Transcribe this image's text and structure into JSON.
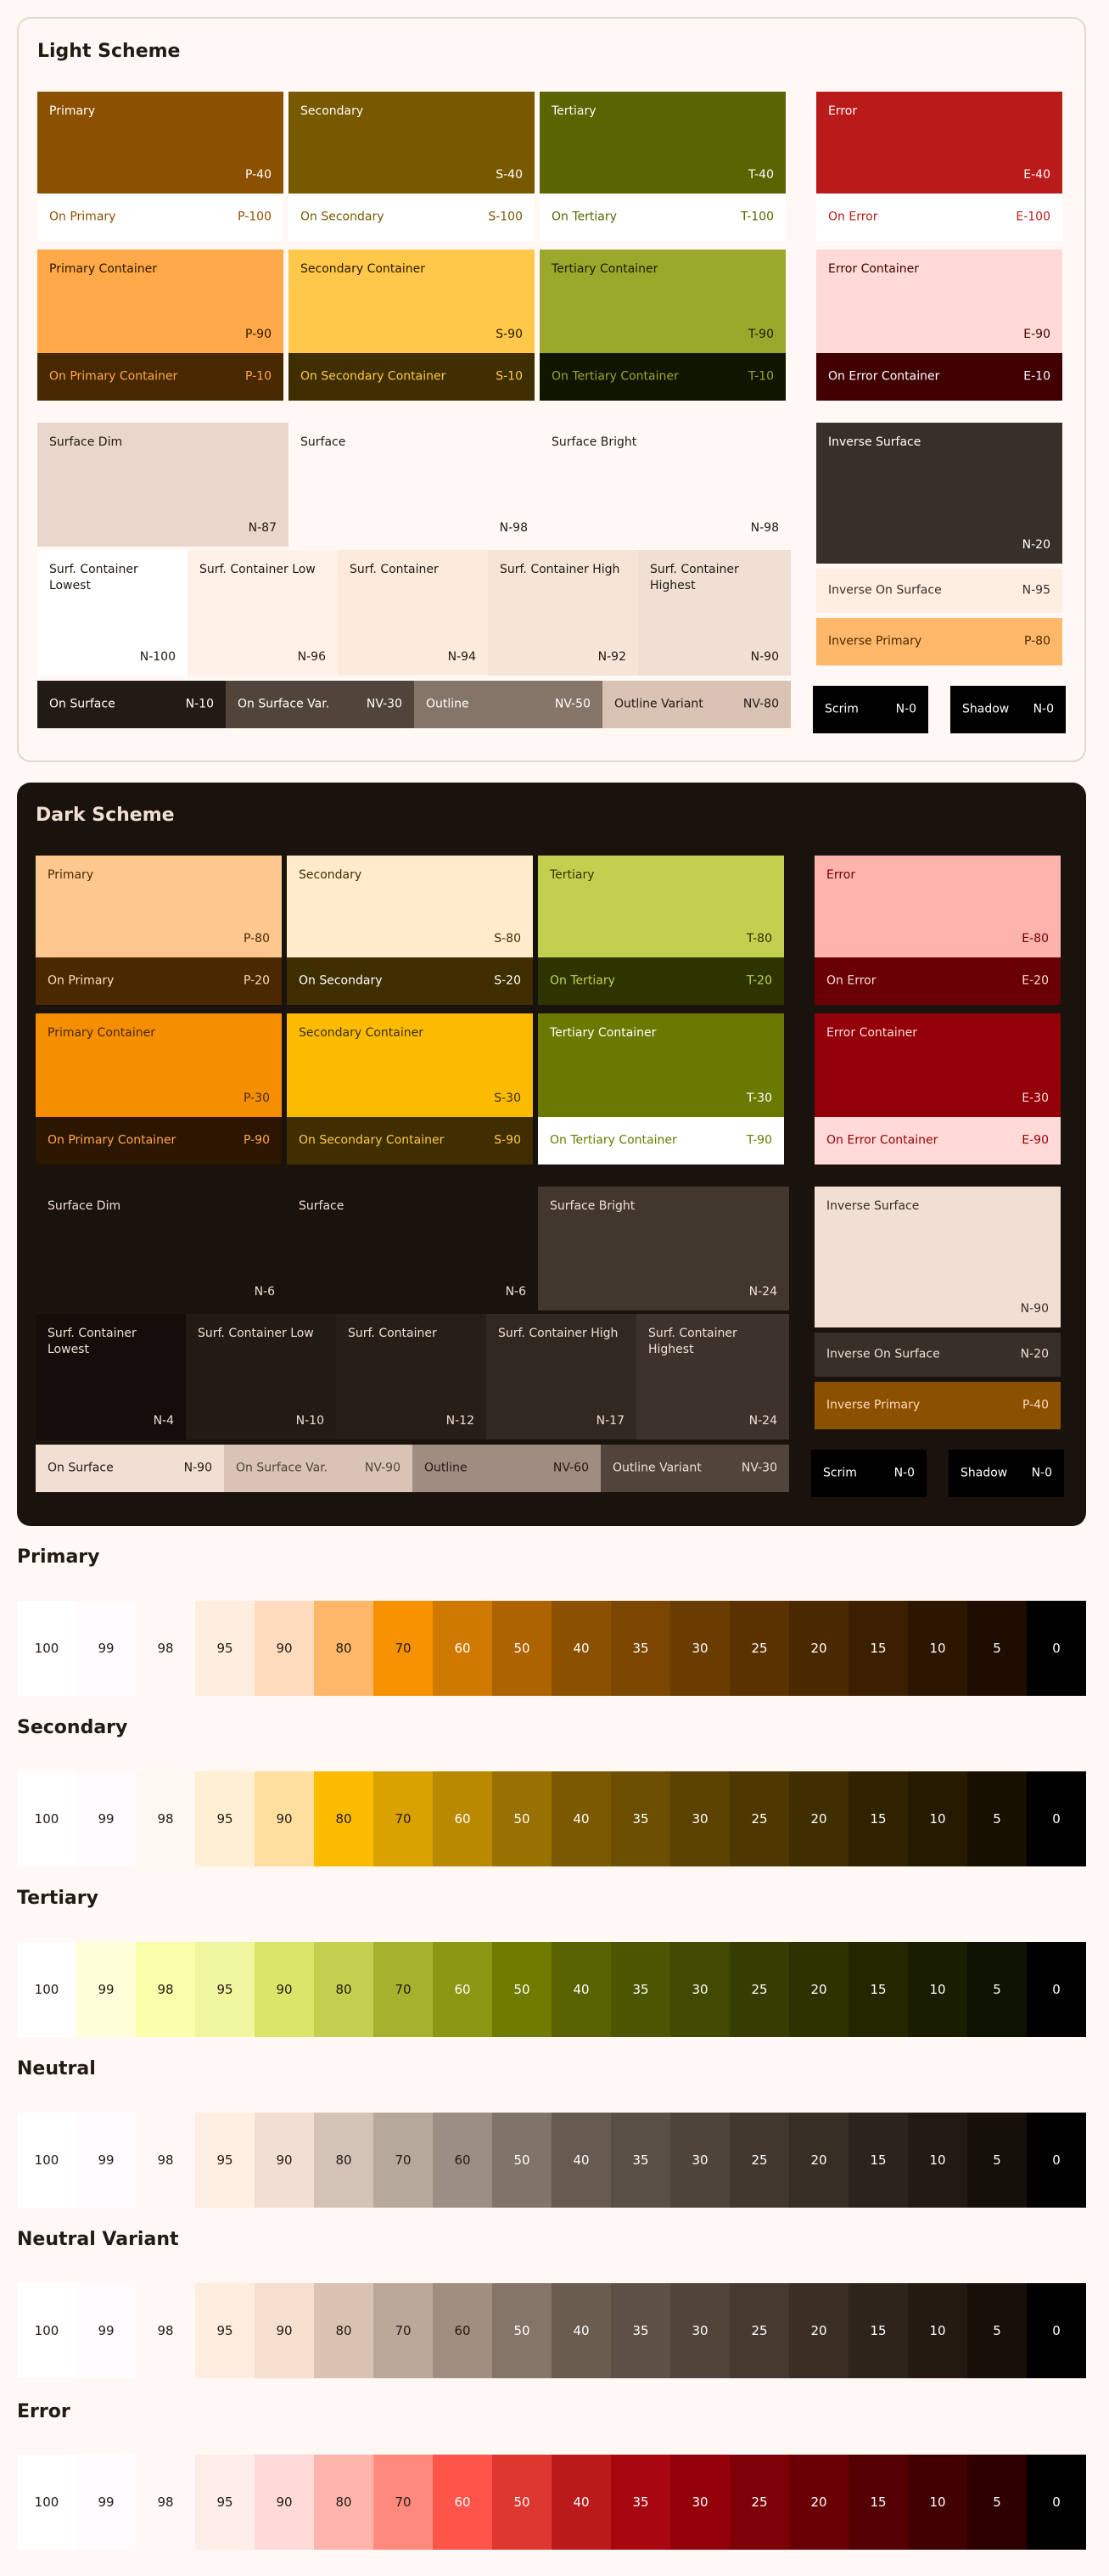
{
  "light": {
    "title": "Light Scheme",
    "tiles": [
      {
        "name": "Primary",
        "code": "P-40",
        "bg": "#8b5000",
        "fg": "#ffffff"
      },
      {
        "name": "Secondary",
        "code": "S-40",
        "bg": "#785900",
        "fg": "#ffffff"
      },
      {
        "name": "Tertiary",
        "code": "T-40",
        "bg": "#5a6400",
        "fg": "#ffffff"
      },
      {
        "name": "Error",
        "code": "E-40",
        "bg": "#ba1a1a",
        "fg": "#ffffff"
      },
      {
        "name": "On Primary",
        "code": "P-100",
        "bg": "#ffffff",
        "fg": "#8b5000"
      },
      {
        "name": "On Secondary",
        "code": "S-100",
        "bg": "#ffffff",
        "fg": "#785900"
      },
      {
        "name": "On Tertiary",
        "code": "T-100",
        "bg": "#ffffff",
        "fg": "#5a6400"
      },
      {
        "name": "On Error",
        "code": "E-100",
        "bg": "#ffffff",
        "fg": "#ba1a1a"
      },
      {
        "name": "Primary Container",
        "code": "P-90",
        "bg": "#ffa948",
        "fg": "#2c1600"
      },
      {
        "name": "Secondary Container",
        "code": "S-90",
        "bg": "#ffc84a",
        "fg": "#261a00"
      },
      {
        "name": "Tertiary Container",
        "code": "T-90",
        "bg": "#9aa82b",
        "fg": "#191e00"
      },
      {
        "name": "Error Container",
        "code": "E-90",
        "bg": "#ffdad6",
        "fg": "#410002"
      },
      {
        "name": "On Primary Container",
        "code": "P-10",
        "bg": "#482800",
        "fg": "#ffa948"
      },
      {
        "name": "On Secondary Container",
        "code": "S-10",
        "bg": "#3f2e00",
        "fg": "#ffc84a"
      },
      {
        "name": "On Tertiary Container",
        "code": "T-10",
        "bg": "#101500",
        "fg": "#9aa82b"
      },
      {
        "name": "On Error Container",
        "code": "E-10",
        "bg": "#410002",
        "fg": "#ffffff"
      },
      {
        "name": "Surface Dim",
        "code": "N-87",
        "bg": "#e8d7ca",
        "fg": "#221a14"
      },
      {
        "name": "Surface",
        "code": "N-98",
        "bg": "#fff8f4",
        "fg": "#221a14"
      },
      {
        "name": "Surface Bright",
        "code": "N-98",
        "bg": "#fff8f4",
        "fg": "#221a14"
      },
      {
        "name": "Inverse Surface",
        "code": "N-20",
        "bg": "#382f28",
        "fg": "#ffffff"
      },
      {
        "name": "Surf. Container Lowest",
        "code": "N-100",
        "bg": "#ffffff",
        "fg": "#221a14"
      },
      {
        "name": "Surf. Container Low",
        "code": "N-96",
        "bg": "#fff1e7",
        "fg": "#221a14"
      },
      {
        "name": "Surf. Container",
        "code": "N-94",
        "bg": "#fcebdd",
        "fg": "#221a14"
      },
      {
        "name": "Surf. Container High",
        "code": "N-92",
        "bg": "#f6e5d7",
        "fg": "#221a14"
      },
      {
        "name": "Surf. Container Highest",
        "code": "N-90",
        "bg": "#f0dfd2",
        "fg": "#221a14"
      },
      {
        "name": "Inverse On Surface",
        "code": "N-95",
        "bg": "#feeee1",
        "fg": "#382f28"
      },
      {
        "name": "Inverse Primary",
        "code": "P-80",
        "bg": "#ffb869",
        "fg": "#4a2a00"
      },
      {
        "name": "On Surface",
        "code": "N-10",
        "bg": "#221a14",
        "fg": "#ffffff"
      },
      {
        "name": "On Surface Var.",
        "code": "NV-30",
        "bg": "#51443a",
        "fg": "#ffffff"
      },
      {
        "name": "Outline",
        "code": "NV-50",
        "bg": "#857468",
        "fg": "#ffffff"
      },
      {
        "name": "Outline Variant",
        "code": "NV-80",
        "bg": "#d8c3b5",
        "fg": "#221a14"
      },
      {
        "name": "Scrim",
        "code": "N-0",
        "bg": "#000000",
        "fg": "#ffffff"
      },
      {
        "name": "Shadow",
        "code": "N-0",
        "bg": "#000000",
        "fg": "#ffffff"
      }
    ]
  },
  "dark": {
    "title": "Dark Scheme",
    "tiles": [
      {
        "name": "Primary",
        "code": "P-80",
        "bg": "#ffc891",
        "fg": "#4a2800"
      },
      {
        "name": "Secondary",
        "code": "S-80",
        "bg": "#ffeccc",
        "fg": "#3f2e00"
      },
      {
        "name": "Tertiary",
        "code": "T-80",
        "bg": "#c3d04f",
        "fg": "#2e3400"
      },
      {
        "name": "Error",
        "code": "E-80",
        "bg": "#ffb4ab",
        "fg": "#690005"
      },
      {
        "name": "On Primary",
        "code": "P-20",
        "bg": "#4a2800",
        "fg": "#ffdcbe"
      },
      {
        "name": "On Secondary",
        "code": "S-20",
        "bg": "#3f2e00",
        "fg": "#ffffff"
      },
      {
        "name": "On Tertiary",
        "code": "T-20",
        "bg": "#2e3400",
        "fg": "#c3d04f"
      },
      {
        "name": "On Error",
        "code": "E-20",
        "bg": "#690005",
        "fg": "#ffdad6"
      },
      {
        "name": "Primary Container",
        "code": "P-30",
        "bg": "#f58f00",
        "fg": "#4a2800"
      },
      {
        "name": "Secondary Container",
        "code": "S-30",
        "bg": "#fbbc00",
        "fg": "#3f2e00"
      },
      {
        "name": "Tertiary Container",
        "code": "T-30",
        "bg": "#6a7a00",
        "fg": "#ffffff"
      },
      {
        "name": "Error Container",
        "code": "E-30",
        "bg": "#93000a",
        "fg": "#ffdad6"
      },
      {
        "name": "On Primary Container",
        "code": "P-90",
        "bg": "#2c1600",
        "fg": "#ffa948"
      },
      {
        "name": "On Secondary Container",
        "code": "S-90",
        "bg": "#3f2e00",
        "fg": "#ffc84a"
      },
      {
        "name": "On Tertiary Container",
        "code": "T-90",
        "bg": "#ffffff",
        "fg": "#6a7a00"
      },
      {
        "name": "On Error Container",
        "code": "E-90",
        "bg": "#ffdad6",
        "fg": "#93000a"
      },
      {
        "name": "Surface Dim",
        "code": "N-6",
        "bg": "#1a120d",
        "fg": "#f0dfd2"
      },
      {
        "name": "Surface",
        "code": "N-6",
        "bg": "#1a120d",
        "fg": "#f0dfd2"
      },
      {
        "name": "Surface Bright",
        "code": "N-24",
        "bg": "#42372f",
        "fg": "#f0dfd2"
      },
      {
        "name": "Inverse Surface",
        "code": "N-90",
        "bg": "#f0dfd2",
        "fg": "#382f28"
      },
      {
        "name": "Surf. Container Lowest",
        "code": "N-4",
        "bg": "#140d09",
        "fg": "#f0dfd2"
      },
      {
        "name": "Surf. Container Low",
        "code": "N-10",
        "bg": "#221a14",
        "fg": "#f0dfd2"
      },
      {
        "name": "Surf. Container",
        "code": "N-12",
        "bg": "#271e18",
        "fg": "#f0dfd2"
      },
      {
        "name": "Surf. Container High",
        "code": "N-17",
        "bg": "#322822",
        "fg": "#f0dfd2"
      },
      {
        "name": "Surf. Container Highest",
        "code": "N-24",
        "bg": "#3d332c",
        "fg": "#f0dfd2"
      },
      {
        "name": "Inverse On Surface",
        "code": "N-20",
        "bg": "#382f28",
        "fg": "#f0dfd2"
      },
      {
        "name": "Inverse Primary",
        "code": "P-40",
        "bg": "#8b5000",
        "fg": "#ffdcbe"
      },
      {
        "name": "On Surface",
        "code": "N-90",
        "bg": "#f0dfd2",
        "fg": "#221a14"
      },
      {
        "name": "On Surface Var.",
        "code": "NV-90",
        "bg": "#d8c3b5",
        "fg": "#51443a"
      },
      {
        "name": "Outline",
        "code": "NV-60",
        "bg": "#a08d81",
        "fg": "#221a14"
      },
      {
        "name": "Outline Variant",
        "code": "NV-30",
        "bg": "#51443a",
        "fg": "#f0dfd2"
      },
      {
        "name": "Scrim",
        "code": "N-0",
        "bg": "#000000",
        "fg": "#ffffff"
      },
      {
        "name": "Shadow",
        "code": "N-0",
        "bg": "#000000",
        "fg": "#ffffff"
      }
    ]
  },
  "palettes": {
    "labels": [
      "100",
      "99",
      "98",
      "95",
      "90",
      "80",
      "70",
      "60",
      "50",
      "40",
      "35",
      "30",
      "25",
      "20",
      "15",
      "10",
      "5",
      "0"
    ],
    "rows": [
      {
        "title": "Primary",
        "colors": [
          "#ffffff",
          "#fffbff",
          "#fff8f4",
          "#ffeee0",
          "#ffdcbe",
          "#ffb869",
          "#f69100",
          "#d07900",
          "#ad6300",
          "#8b5000",
          "#7a4600",
          "#6a3c00",
          "#5a3200",
          "#4a2800",
          "#3b1f00",
          "#2c1600",
          "#1e0d00",
          "#000000"
        ]
      },
      {
        "title": "Secondary",
        "colors": [
          "#ffffff",
          "#fffbff",
          "#fff8f2",
          "#ffefd4",
          "#ffdf9e",
          "#fbbc00",
          "#d9a200",
          "#b98900",
          "#997100",
          "#7b5900",
          "#6b4e00",
          "#5c4200",
          "#4e3700",
          "#3f2e00",
          "#312200",
          "#261a00",
          "#170f00",
          "#000000"
        ]
      },
      {
        "title": "Tertiary",
        "colors": [
          "#ffffff",
          "#fcffd8",
          "#f8fea9",
          "#eef79e",
          "#dbe56a",
          "#c3d04f",
          "#a6b22d",
          "#8a9712",
          "#6f7c00",
          "#586300",
          "#4c5600",
          "#414a00",
          "#353d00",
          "#2d3300",
          "#222700",
          "#191e00",
          "#0e1200",
          "#000000"
        ]
      },
      {
        "title": "Neutral",
        "colors": [
          "#ffffff",
          "#fffbff",
          "#fff8f4",
          "#ffeee1",
          "#f0dfd2",
          "#d3c3b7",
          "#b7a89c",
          "#9b8e82",
          "#807469",
          "#675b51",
          "#5a4f46",
          "#4e443b",
          "#42382f",
          "#372e26",
          "#2b231c",
          "#211a14",
          "#16100a",
          "#000000"
        ]
      },
      {
        "title": "Neutral Variant",
        "colors": [
          "#ffffff",
          "#fffbff",
          "#fff8f4",
          "#ffeee0",
          "#f5dfce",
          "#d8c3b3",
          "#bca899",
          "#a08e80",
          "#857468",
          "#6b5c50",
          "#5f5045",
          "#52443a",
          "#46392f",
          "#3b2e25",
          "#2f241b",
          "#241a11",
          "#180f08",
          "#000000"
        ]
      },
      {
        "title": "Error",
        "colors": [
          "#ffffff",
          "#fffbff",
          "#fff8f7",
          "#ffedea",
          "#ffdad6",
          "#ffb4ab",
          "#ff897d",
          "#ff5449",
          "#de3730",
          "#ba1a1a",
          "#a80710",
          "#93000a",
          "#7e0007",
          "#690005",
          "#540003",
          "#410002",
          "#2d0001",
          "#000000"
        ]
      }
    ]
  }
}
